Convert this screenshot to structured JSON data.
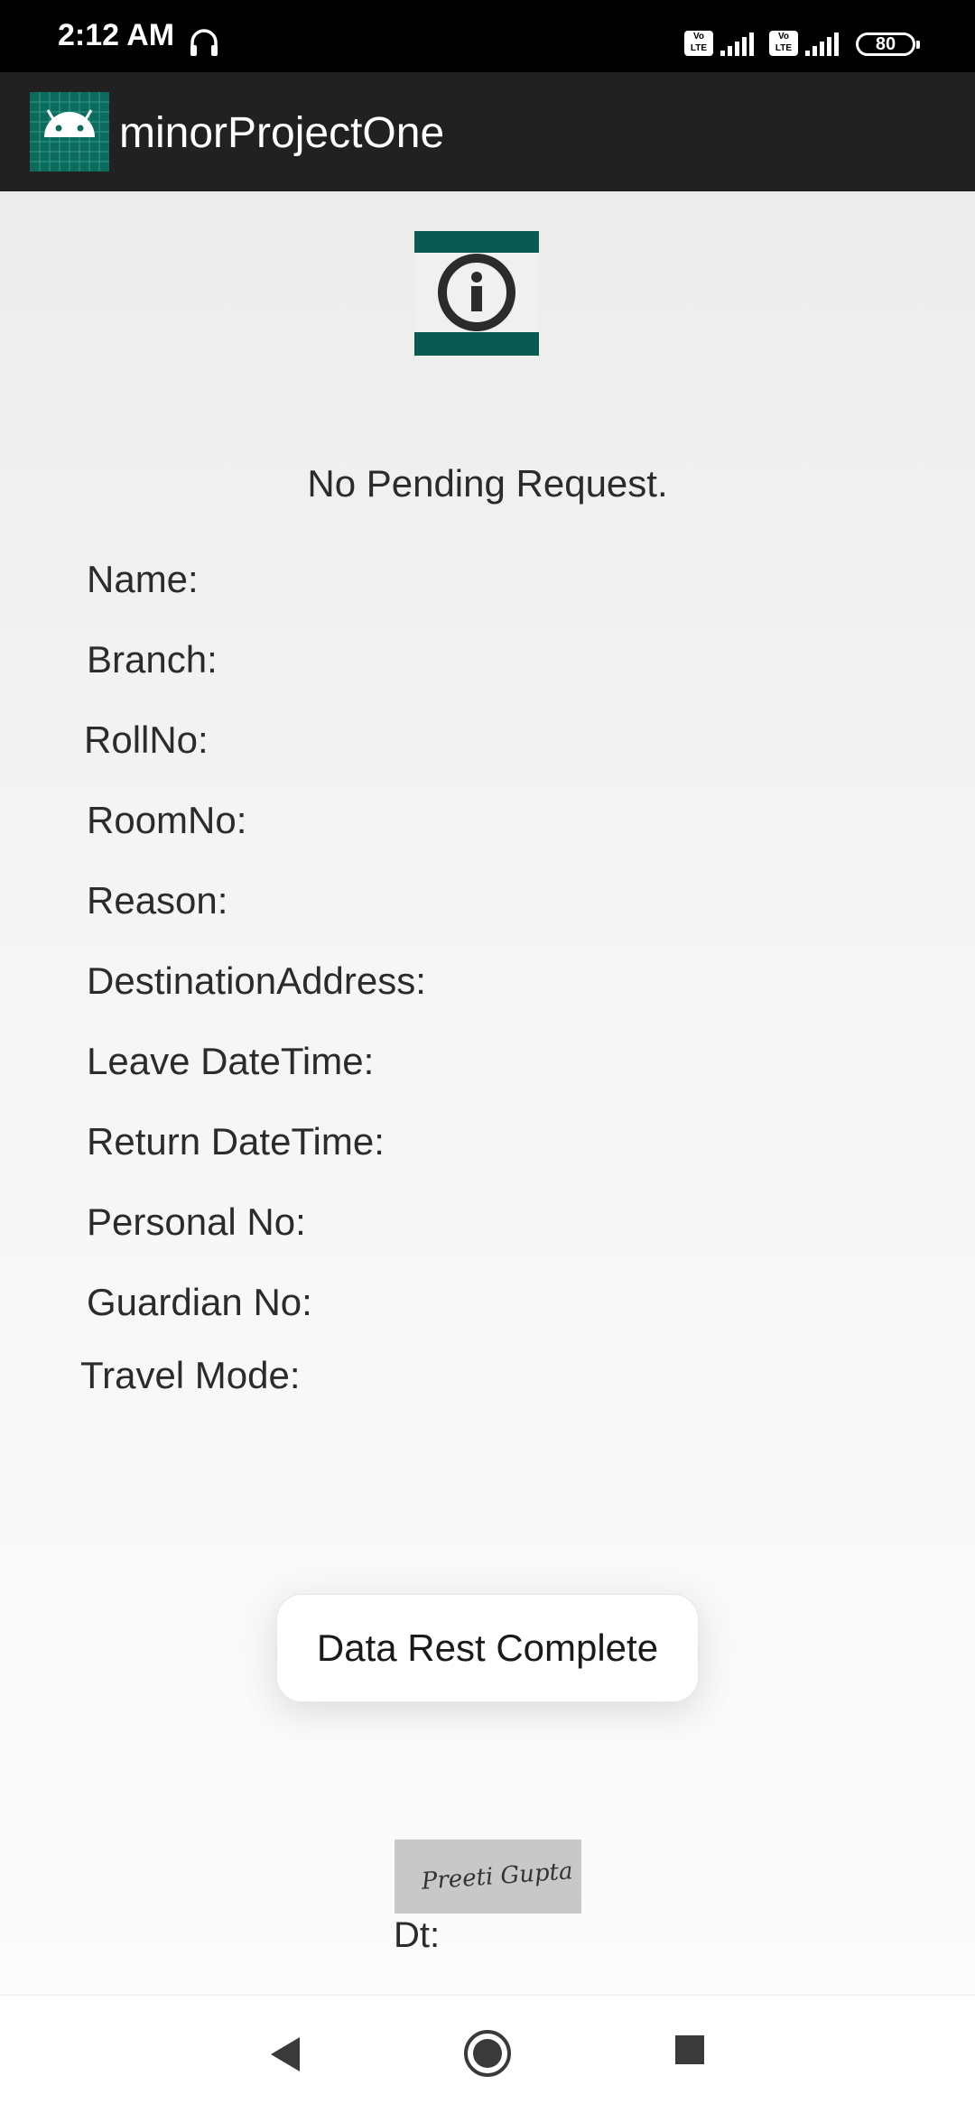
{
  "status_bar": {
    "time": "2:12 AM",
    "sim1_badge": "Vo LTE",
    "sim2_badge": "Vo LTE",
    "battery": "80",
    "icons": [
      "headset-icon",
      "signal-icon",
      "signal-icon",
      "battery-icon"
    ]
  },
  "app_bar": {
    "title": "minorProjectOne",
    "logo_icon": "android-icon"
  },
  "main": {
    "info_icon": "info-icon",
    "pending_message": "No Pending Request.",
    "fields": {
      "name": "Name:",
      "branch": "Branch:",
      "roll_no": "RollNo:",
      "room_no": "RoomNo:",
      "reason": "Reason:",
      "destination": "DestinationAddress:",
      "leave_datetime": "Leave DateTime:",
      "return_datetime": "Return DateTime:",
      "personal_no": "Personal No:",
      "guardian_no": "Guardian No:",
      "travel_mode": "Travel Mode:"
    },
    "signature_text": "Preeti Gupta",
    "date_label": "Dt:"
  },
  "toast": {
    "message": "Data Rest Complete"
  },
  "nav_bar": {
    "icons": [
      "back-icon",
      "home-icon",
      "recents-icon"
    ]
  },
  "colors": {
    "status_bar": "#000000",
    "app_bar": "#212121",
    "logo_teal": "#0d6b5e",
    "info_band": "#0b5a52"
  }
}
